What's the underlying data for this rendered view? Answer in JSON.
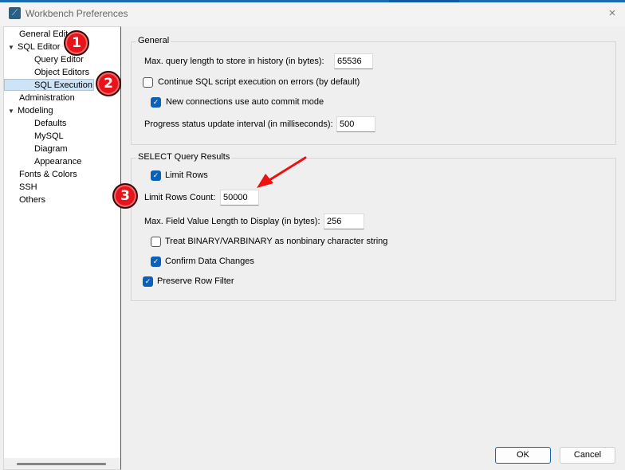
{
  "window": {
    "title": "Workbench Preferences",
    "app_icon": "mysql-workbench-dolphin-icon",
    "close_icon": "×"
  },
  "sidebar": {
    "items": [
      {
        "label": "General Editors",
        "visible_label": "General Edit",
        "level": 0,
        "expanded": null,
        "selected": false
      },
      {
        "label": "SQL Editor",
        "level": 0,
        "expanded": true,
        "selected": false
      },
      {
        "label": "Query Editor",
        "level": 1,
        "selected": false
      },
      {
        "label": "Object Editors",
        "level": 1,
        "selected": false
      },
      {
        "label": "SQL Execution",
        "level": 1,
        "selected": true
      },
      {
        "label": "Administration",
        "level": 0,
        "selected": false
      },
      {
        "label": "Modeling",
        "level": 0,
        "expanded": true,
        "selected": false
      },
      {
        "label": "Defaults",
        "level": 1,
        "selected": false
      },
      {
        "label": "MySQL",
        "level": 1,
        "selected": false
      },
      {
        "label": "Diagram",
        "level": 1,
        "selected": false
      },
      {
        "label": "Appearance",
        "level": 1,
        "selected": false
      },
      {
        "label": "Fonts & Colors",
        "level": 0,
        "selected": false
      },
      {
        "label": "SSH",
        "level": 0,
        "selected": false
      },
      {
        "label": "Others",
        "level": 0,
        "selected": false
      }
    ],
    "expand_arrow": "▼"
  },
  "general": {
    "title": "General",
    "max_query_length_label": "Max. query length to store in history (in bytes):",
    "max_query_length_value": "65536",
    "continue_on_errors_label": "Continue SQL script execution on errors (by default)",
    "continue_on_errors_checked": false,
    "auto_commit_label": "New connections use auto commit mode",
    "auto_commit_checked": true,
    "progress_interval_label": "Progress status update interval (in milliseconds):",
    "progress_interval_value": "500"
  },
  "select_results": {
    "title": "SELECT Query Results",
    "limit_rows_label": "Limit Rows",
    "limit_rows_checked": true,
    "limit_rows_count_label": "Limit Rows Count:",
    "limit_rows_count_value": "50000",
    "max_field_length_label": "Max. Field Value Length to Display (in bytes):",
    "max_field_length_value": "256",
    "treat_binary_label": "Treat BINARY/VARBINARY as nonbinary character string",
    "treat_binary_checked": false,
    "confirm_changes_label": "Confirm Data Changes",
    "confirm_changes_checked": true,
    "preserve_filter_label": "Preserve Row Filter",
    "preserve_filter_checked": true
  },
  "buttons": {
    "ok": "OK",
    "cancel": "Cancel"
  },
  "annotations": {
    "badges": [
      "1",
      "2",
      "3"
    ],
    "badge_color": "#e8141b",
    "arrow_color": "#ee1111"
  },
  "colors": {
    "accent": "#0b60b8",
    "selection": "#cce4f7"
  },
  "checkmark": "✓"
}
